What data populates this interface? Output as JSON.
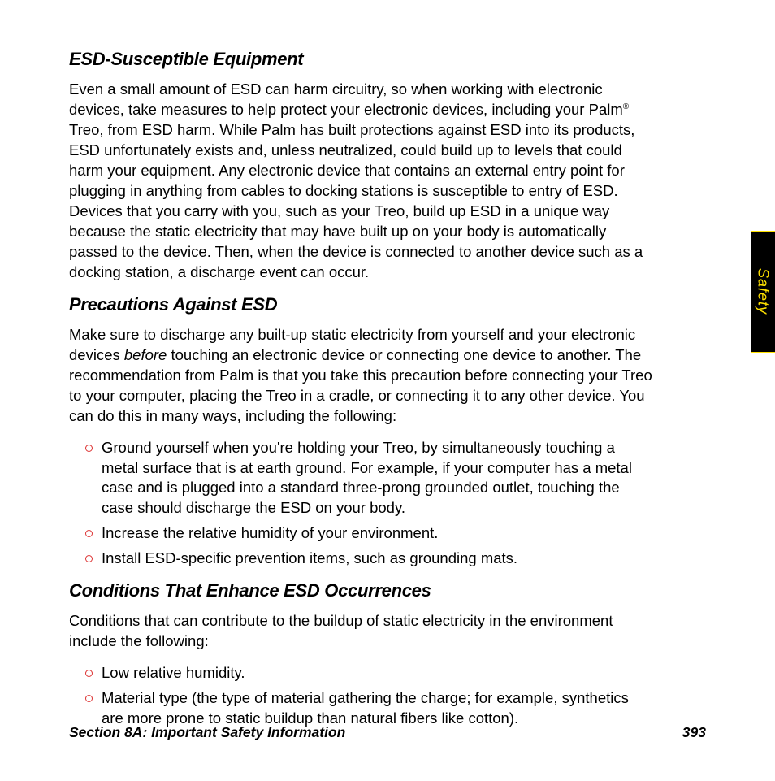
{
  "sideTab": "Safety",
  "sections": [
    {
      "heading": "ESD-Susceptible Equipment",
      "paraHtml": "Even a small amount of ESD can harm circuitry, so when working with electronic devices, take measures to help protect your electronic devices, including your Palm<sup>®</sup> Treo, from ESD harm. While Palm has built protections against ESD into its products, ESD unfortunately exists and, unless neutralized, could build up to levels that could harm your equipment. Any electronic device that contains an external entry point for plugging in anything from cables to docking stations is susceptible to entry of ESD. Devices that you carry with you, such as your Treo, build up ESD in a unique way because the static electricity that may have built up on your body is automatically passed to the device. Then, when the device is connected to another device such as a docking station, a discharge event can occur."
    },
    {
      "heading": "Precautions Against ESD",
      "paraHtml": "Make sure to discharge any built-up static electricity from yourself and your electronic devices <span class=\"italic\">before</span> touching an electronic device or connecting one device to another. The recommendation from Palm is that you take this precaution before connecting your Treo to your computer, placing the Treo in a cradle, or connecting it to any other device. You can do this in many ways, including the following:",
      "bullets": [
        "Ground yourself when you're holding your Treo, by simultaneously touching a metal surface that is at earth ground. For example, if your computer has a metal case and is plugged into a standard three-prong grounded outlet, touching the case should discharge the ESD on your body.",
        "Increase the relative humidity of your environment.",
        "Install ESD-specific prevention items, such as grounding mats."
      ]
    },
    {
      "heading": "Conditions That Enhance ESD Occurrences",
      "paraHtml": "Conditions that can contribute to the buildup of static electricity in the environment include the following:",
      "bullets": [
        "Low relative humidity.",
        "Material type (the type of material gathering the charge; for example, synthetics are more prone to static buildup than natural fibers like cotton)."
      ]
    }
  ],
  "footer": {
    "section": "Section 8A: Important Safety Information",
    "page": "393"
  }
}
